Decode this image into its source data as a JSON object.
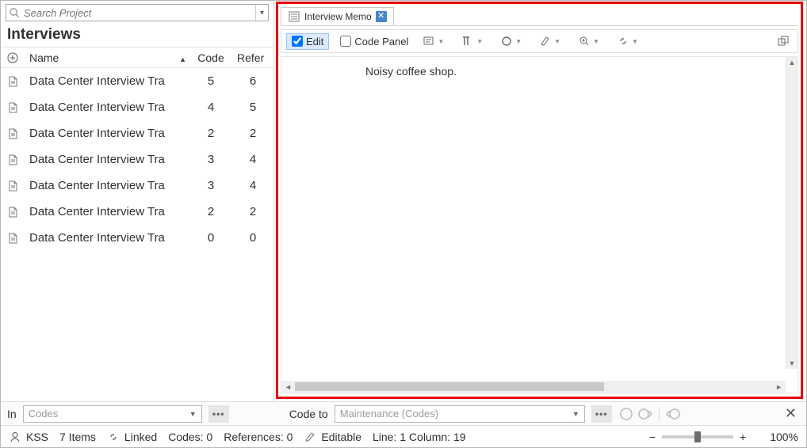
{
  "search": {
    "placeholder": "Search Project"
  },
  "panel": {
    "title": "Interviews",
    "columns": {
      "name": "Name",
      "code": "Code",
      "refer": "Refer"
    }
  },
  "rows": [
    {
      "name": "Data Center Interview Tra",
      "code": "5",
      "refer": "6"
    },
    {
      "name": "Data Center Interview Tra",
      "code": "4",
      "refer": "5"
    },
    {
      "name": "Data Center Interview Tra",
      "code": "2",
      "refer": "2"
    },
    {
      "name": "Data Center Interview Tra",
      "code": "3",
      "refer": "4"
    },
    {
      "name": "Data Center Interview Tra",
      "code": "3",
      "refer": "4"
    },
    {
      "name": "Data Center Interview Tra",
      "code": "2",
      "refer": "2"
    },
    {
      "name": "Data Center Interview Tra",
      "code": "0",
      "refer": "0"
    }
  ],
  "tab": {
    "label": "Interview Memo"
  },
  "toolbar": {
    "edit": "Edit",
    "codepanel": "Code Panel"
  },
  "document": {
    "text": "Noisy coffee shop."
  },
  "bar1": {
    "in_label": "In",
    "in_value": "Codes",
    "codeto_label": "Code to",
    "codeto_value": "Maintenance (Codes)"
  },
  "status": {
    "user": "KSS",
    "items": "7 Items",
    "linked": "Linked",
    "codes": "Codes: 0",
    "refs": "References: 0",
    "editable": "Editable",
    "pos": "Line: 1 Column: 19",
    "zoom": "100%"
  }
}
